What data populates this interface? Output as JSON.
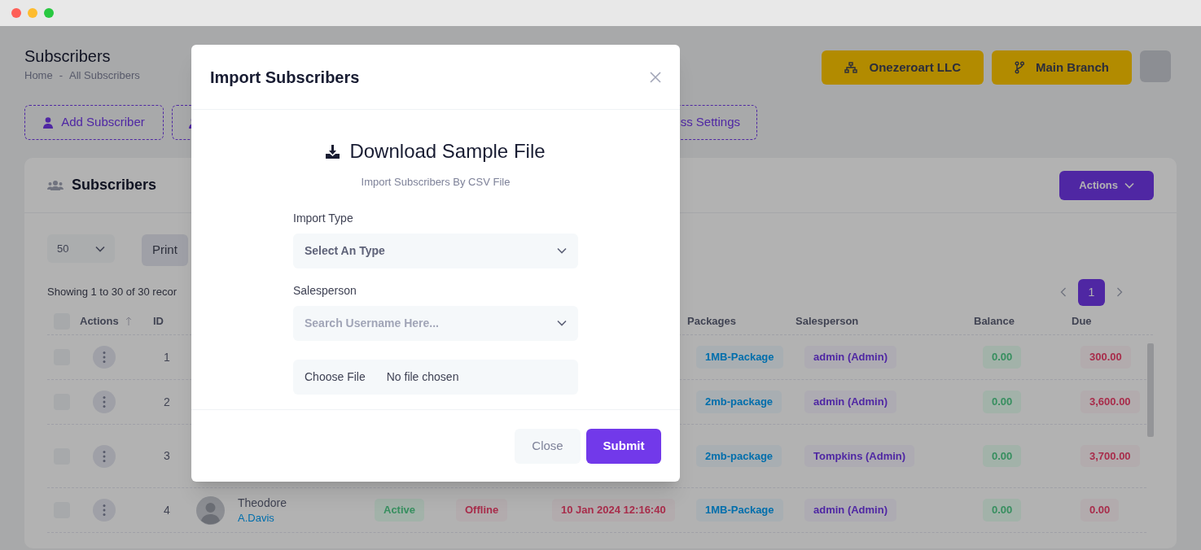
{
  "page": {
    "title": "Subscribers",
    "breadcrumb": [
      "Home",
      "All Subscribers"
    ],
    "breadcrumb_separator": "-"
  },
  "header_buttons": [
    {
      "label": "Onezeroart LLC"
    },
    {
      "label": "Main Branch"
    }
  ],
  "toolbar_buttons": [
    {
      "label": "Add Subscriber"
    },
    {
      "label": "ss Settings"
    }
  ],
  "card": {
    "title": "Subscribers",
    "actions_button": "Actions",
    "page_size": "50",
    "print_button": "Print",
    "showing": "Showing 1 to 30 of 30 recor",
    "pages": [
      {
        "label": "1",
        "selected": true
      }
    ]
  },
  "table": {
    "columns": [
      {
        "kind": "checkbox",
        "checked": false
      },
      {
        "kind": "text",
        "label": "Actions",
        "sortable": true
      },
      {
        "kind": "text",
        "label": "ID"
      },
      {
        "kind": "text",
        "label": "Packages"
      },
      {
        "kind": "text",
        "label": "Salesperson"
      },
      {
        "kind": "text",
        "label": "Balance"
      },
      {
        "kind": "text",
        "label": "Due"
      }
    ],
    "rows": [
      {
        "selected": false,
        "id": "1",
        "package": "1MB-Package",
        "salesperson": "admin (Admin)",
        "balance": "0.00",
        "due": "300.00"
      },
      {
        "selected": false,
        "id": "2",
        "package": "2mb-package",
        "salesperson": "admin (Admin)",
        "balance": "0.00",
        "due": "3,600.00"
      },
      {
        "selected": false,
        "id": "3",
        "package": "2mb-package",
        "salesperson": "Tompkins (Admin)",
        "balance": "0.00",
        "due": "3,700.00"
      },
      {
        "selected": false,
        "id": "4",
        "subscriber": {
          "name": "Theodore",
          "username": "A.Davis"
        },
        "status": "Active",
        "connection": "Offline",
        "last_seen": "10 Jan 2024 12:16:40",
        "package": "1MB-Package",
        "salesperson": "admin (Admin)",
        "balance": "0.00",
        "due": "0.00"
      }
    ]
  },
  "modal": {
    "title": "Import Subscribers",
    "download_link": "Download Sample File",
    "subtitle": "Import Subscribers By CSV File",
    "fields": [
      {
        "kind": "select",
        "label": "Import Type",
        "value": "Select An Type"
      },
      {
        "kind": "search",
        "label": "Salesperson",
        "placeholder": "Search Username Here..."
      }
    ],
    "file": {
      "button": "Choose File",
      "status": "No file chosen"
    },
    "buttons": [
      {
        "kind": "secondary",
        "label": "Close"
      },
      {
        "kind": "primary",
        "label": "Submit"
      }
    ]
  }
}
